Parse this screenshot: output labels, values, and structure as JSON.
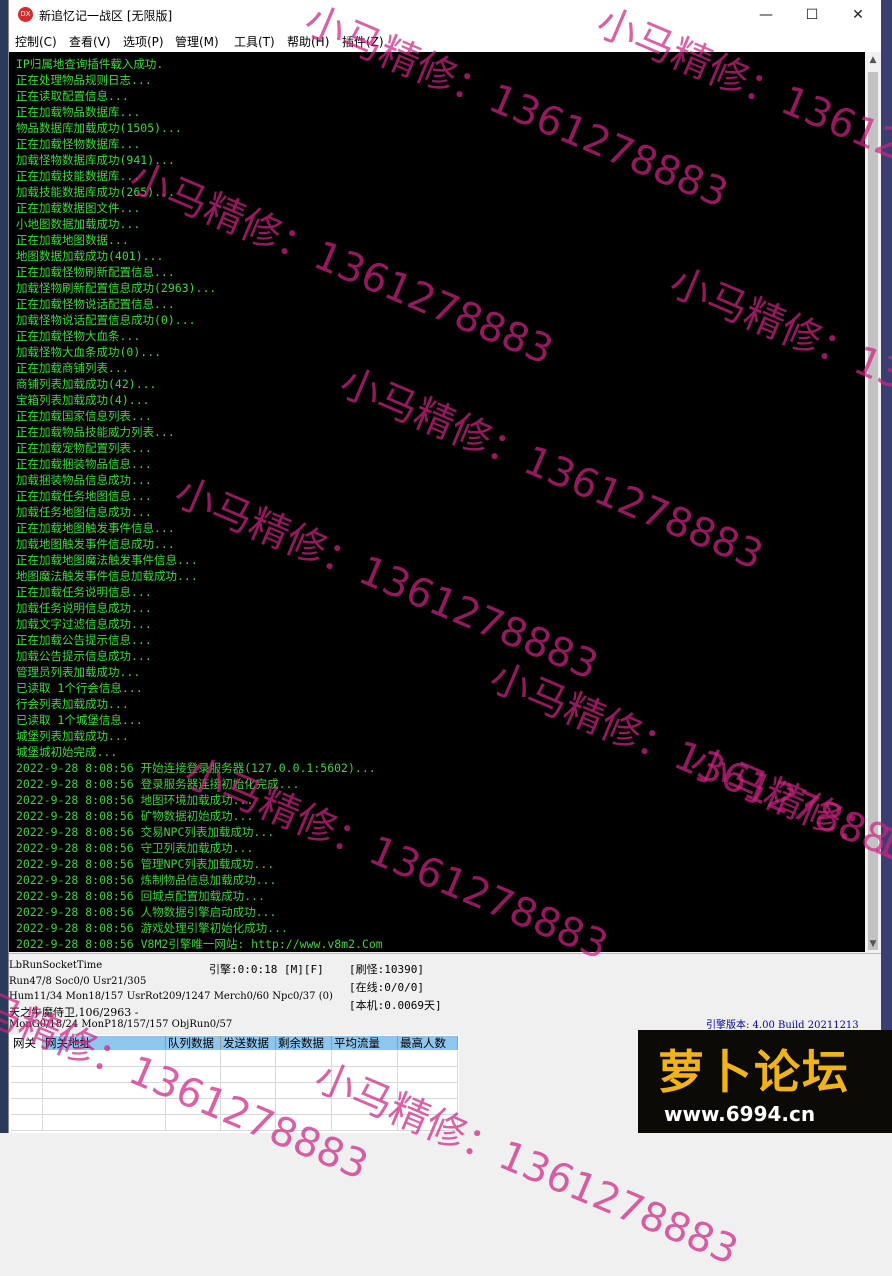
{
  "window": {
    "title": "新追忆记一战区 [无限版]",
    "icon": "app-icon",
    "controls": {
      "minimize": "—",
      "maximize": "☐",
      "close": "✕"
    }
  },
  "menu": [
    "控制(C)",
    "查看(V)",
    "选项(P)",
    "管理(M)",
    "工具(T)",
    "帮助(H)",
    "插件(Z)"
  ],
  "console_lines": [
    "IP归属地查询插件载入成功.",
    "正在处理物品规则日志...",
    "正在读取配置信息...",
    "正在加载物品数据库...",
    "物品数据库加载成功(1505)...",
    "正在加载怪物数据库...",
    "加载怪物数据库成功(941)...",
    "正在加载技能数据库...",
    "加载技能数据库成功(265)...",
    "正在加载数据图文件...",
    "小地图数据加载成功...",
    "正在加载地图数据...",
    "地图数据加载成功(401)...",
    "正在加载怪物刷新配置信息...",
    "加载怪物刷新配置信息成功(2963)...",
    "正在加载怪物说话配置信息...",
    "加载怪物说话配置信息成功(0)...",
    "正在加载怪物大血条...",
    "加载怪物大血条成功(0)...",
    "正在加载商铺列表...",
    "商铺列表加载成功(42)...",
    "宝箱列表加载成功(4)...",
    "正在加载国家信息列表...",
    "正在加载物品技能威力列表...",
    "正在加载宠物配置列表...",
    "正在加载捆装物品信息...",
    "加载捆装物品信息成功...",
    "正在加载任务地图信息...",
    "加载任务地图信息成功...",
    "正在加载地图触发事件信息...",
    "加载地图触发事件信息成功...",
    "正在加载地图魔法触发事件信息...",
    "地图魔法触发事件信息加载成功...",
    "正在加载任务说明信息...",
    "加载任务说明信息成功...",
    "加载文字过滤信息成功...",
    "正在加载公告提示信息...",
    "加载公告提示信息成功...",
    "管理员列表加载成功...",
    "已读取 1个行会信息...",
    "行会列表加载成功...",
    "已读取 1个城堡信息...",
    "城堡列表加载成功...",
    "城堡城初始完成...",
    "2022-9-28 8:08:56 开始连接登录服务器(127.0.0.1:5602)...",
    "2022-9-28 8:08:56 登录服务器连接初始化完成...",
    "2022-9-28 8:08:56 地图环境加载成功...",
    "2022-9-28 8:08:56 矿物数据初始成功...",
    "2022-9-28 8:08:56 交易NPC列表加载成功...",
    "2022-9-28 8:08:56 守卫列表加载成功...",
    "2022-9-28 8:08:56 管理NPC列表加载成功...",
    "2022-9-28 8:08:56 炼制物品信息加载成功...",
    "2022-9-28 8:08:56 回城点配置加载成功...",
    "2022-9-28 8:08:56 人物数据引擎启动成功...",
    "2022-9-28 8:08:56 游戏处理引擎初始化成功...",
    "2022-9-28 8:08:56 V8M2引擎唯一网站: http://www.v8m2.Com"
  ],
  "status": {
    "line1": "LbRunSocketTime",
    "engine_time": "引擎:0:0:18 [M][F]",
    "line2": "Run47/8 Soc0/0 Usr21/305",
    "line3": "Hum11/34 Mon18/157 UsrRot209/1247 Merch0/60 Npc0/37 (0)",
    "line4": "天之牛魔侍卫,106/2963 -",
    "line5": "MonG0/18/24 MonP18/157/157 ObjRun0/57",
    "refresh": "[刷怪:10390]",
    "online": "[在线:0/0/0]",
    "local": "[本机:0.0069天]",
    "version": "引擎版本: 4.00 Build 20211213"
  },
  "gateway_table": {
    "headers": [
      "网关",
      "网关地址",
      "队列数据",
      "发送数据",
      "剩余数据",
      "平均流量",
      "最高人数"
    ]
  },
  "logo": {
    "text": "萝卜论坛",
    "url": "www.6994.cn"
  },
  "watermark": "小马精修：1361278883"
}
